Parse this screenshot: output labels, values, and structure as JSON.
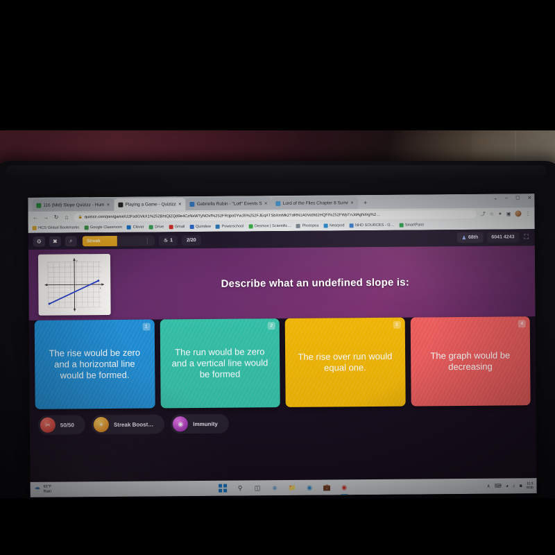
{
  "browser": {
    "tabs": [
      {
        "label": "116 (Mid) Slope Quizizz - Hum",
        "favicon": "#2f9e44",
        "active": false
      },
      {
        "label": "Playing a Game - Quizizz",
        "favicon": "#2b2b2b",
        "active": true
      },
      {
        "label": "Gabriella Rubin - \"Lotf\" Events S",
        "favicon": "#3b82d6",
        "active": false
      },
      {
        "label": "Lord of the Flies Chapter 8 Sumr",
        "favicon": "#4aa3e0",
        "active": false
      }
    ],
    "new_tab_label": "+",
    "window_controls": {
      "minimize": "–",
      "maximize": "☐",
      "close": "✕",
      "chevron": "⌄"
    },
    "nav": {
      "back": "←",
      "forward": "→",
      "reload": "↻",
      "home": "⌂"
    },
    "url": "quizizz.com/join/game/U2FsdGVkX1%252BhtQlZQd9e4CzNsW7yNOvf%252FRrjpo0YwJ6%252FJEqXTSbXmMk2TdRN1A0Va9Id2HQFl%252FWpTnJdAgN4rg%2…",
    "lock_icon": "ὑ2",
    "omni_icons": {
      "share": "⤴",
      "star": "☆",
      "extension": "✦",
      "sidepanel": "▣",
      "menu": "⋮"
    },
    "bookmarks": [
      {
        "label": "HCS Global Bookmarks",
        "color": "#e8b33a"
      },
      {
        "label": "Google Classroom",
        "color": "#3f9e4d"
      },
      {
        "label": "Clever",
        "color": "#1878d2"
      },
      {
        "label": "Drive",
        "color": "#39a85b"
      },
      {
        "label": "Gmail",
        "color": "#d93025"
      },
      {
        "label": "Quindew",
        "color": "#2b6fd4"
      },
      {
        "label": "Powerschool",
        "color": "#2e7fc0"
      },
      {
        "label": "Desmos | Scientific…",
        "color": "#3cb44b"
      },
      {
        "label": "Photopea",
        "color": "#7d8a96"
      },
      {
        "label": "Nearpod",
        "color": "#2d8fd5"
      },
      {
        "label": "NHD SOURCES - G…",
        "color": "#3b82d6"
      },
      {
        "label": "SmartPass",
        "color": "#2faa52"
      }
    ]
  },
  "game": {
    "toolbar": {
      "settings_icon": "⚙",
      "mute_icon": "✖",
      "zoom_icon": "⌕",
      "streak_label": "Streak",
      "streak_progress_pct": 48,
      "streak_count": "1",
      "streak_count_icon": "♨",
      "progress": "2/20",
      "rank": "68th",
      "rank_icon": "♟",
      "score": "6041 4243",
      "fullscreen_icon": "⛶"
    },
    "question": {
      "text": "Describe what an undefined slope is:",
      "image_alt": "coordinate-grid-with-positive-slope-line"
    },
    "answers": [
      {
        "num": "1",
        "text": "The rise would be zero and a horizontal line would be formed.",
        "color": "#1f8ed6"
      },
      {
        "num": "2",
        "text": "The run would be zero and a vertical line would be formed",
        "color": "#34c0a8"
      },
      {
        "num": "3",
        "text": "The rise over run would equal one.",
        "color": "#f2b705"
      },
      {
        "num": "4",
        "text": "The graph would be decreasing",
        "color": "#ef5d5d"
      }
    ],
    "powerups": [
      {
        "label": "50/50",
        "color": "#e8483f",
        "icon": "✂"
      },
      {
        "label": "Streak Boost…",
        "color": "#f5a623",
        "icon": "☀"
      },
      {
        "label": "Immunity",
        "color": "#c13bc6",
        "icon": "◉"
      }
    ]
  },
  "taskbar": {
    "weather": {
      "temp": "65°F",
      "condition": "Rain",
      "icon": "☂"
    },
    "items": [
      {
        "name": "start",
        "icon": "windows"
      },
      {
        "name": "search",
        "icon": "⌕"
      },
      {
        "name": "task-view",
        "icon": "▧"
      },
      {
        "name": "chat",
        "icon": "○"
      },
      {
        "name": "file-explorer",
        "icon": "▤"
      },
      {
        "name": "edge",
        "icon": "◔"
      },
      {
        "name": "store",
        "icon": "▦"
      },
      {
        "name": "chrome",
        "icon": "●"
      }
    ],
    "tray": {
      "chevron": "∧",
      "keyboard": "⌨",
      "wifi": "◠",
      "volume": "✕",
      "battery": "▭"
    },
    "clock": {
      "time": "11:3",
      "date": "9/30"
    }
  }
}
